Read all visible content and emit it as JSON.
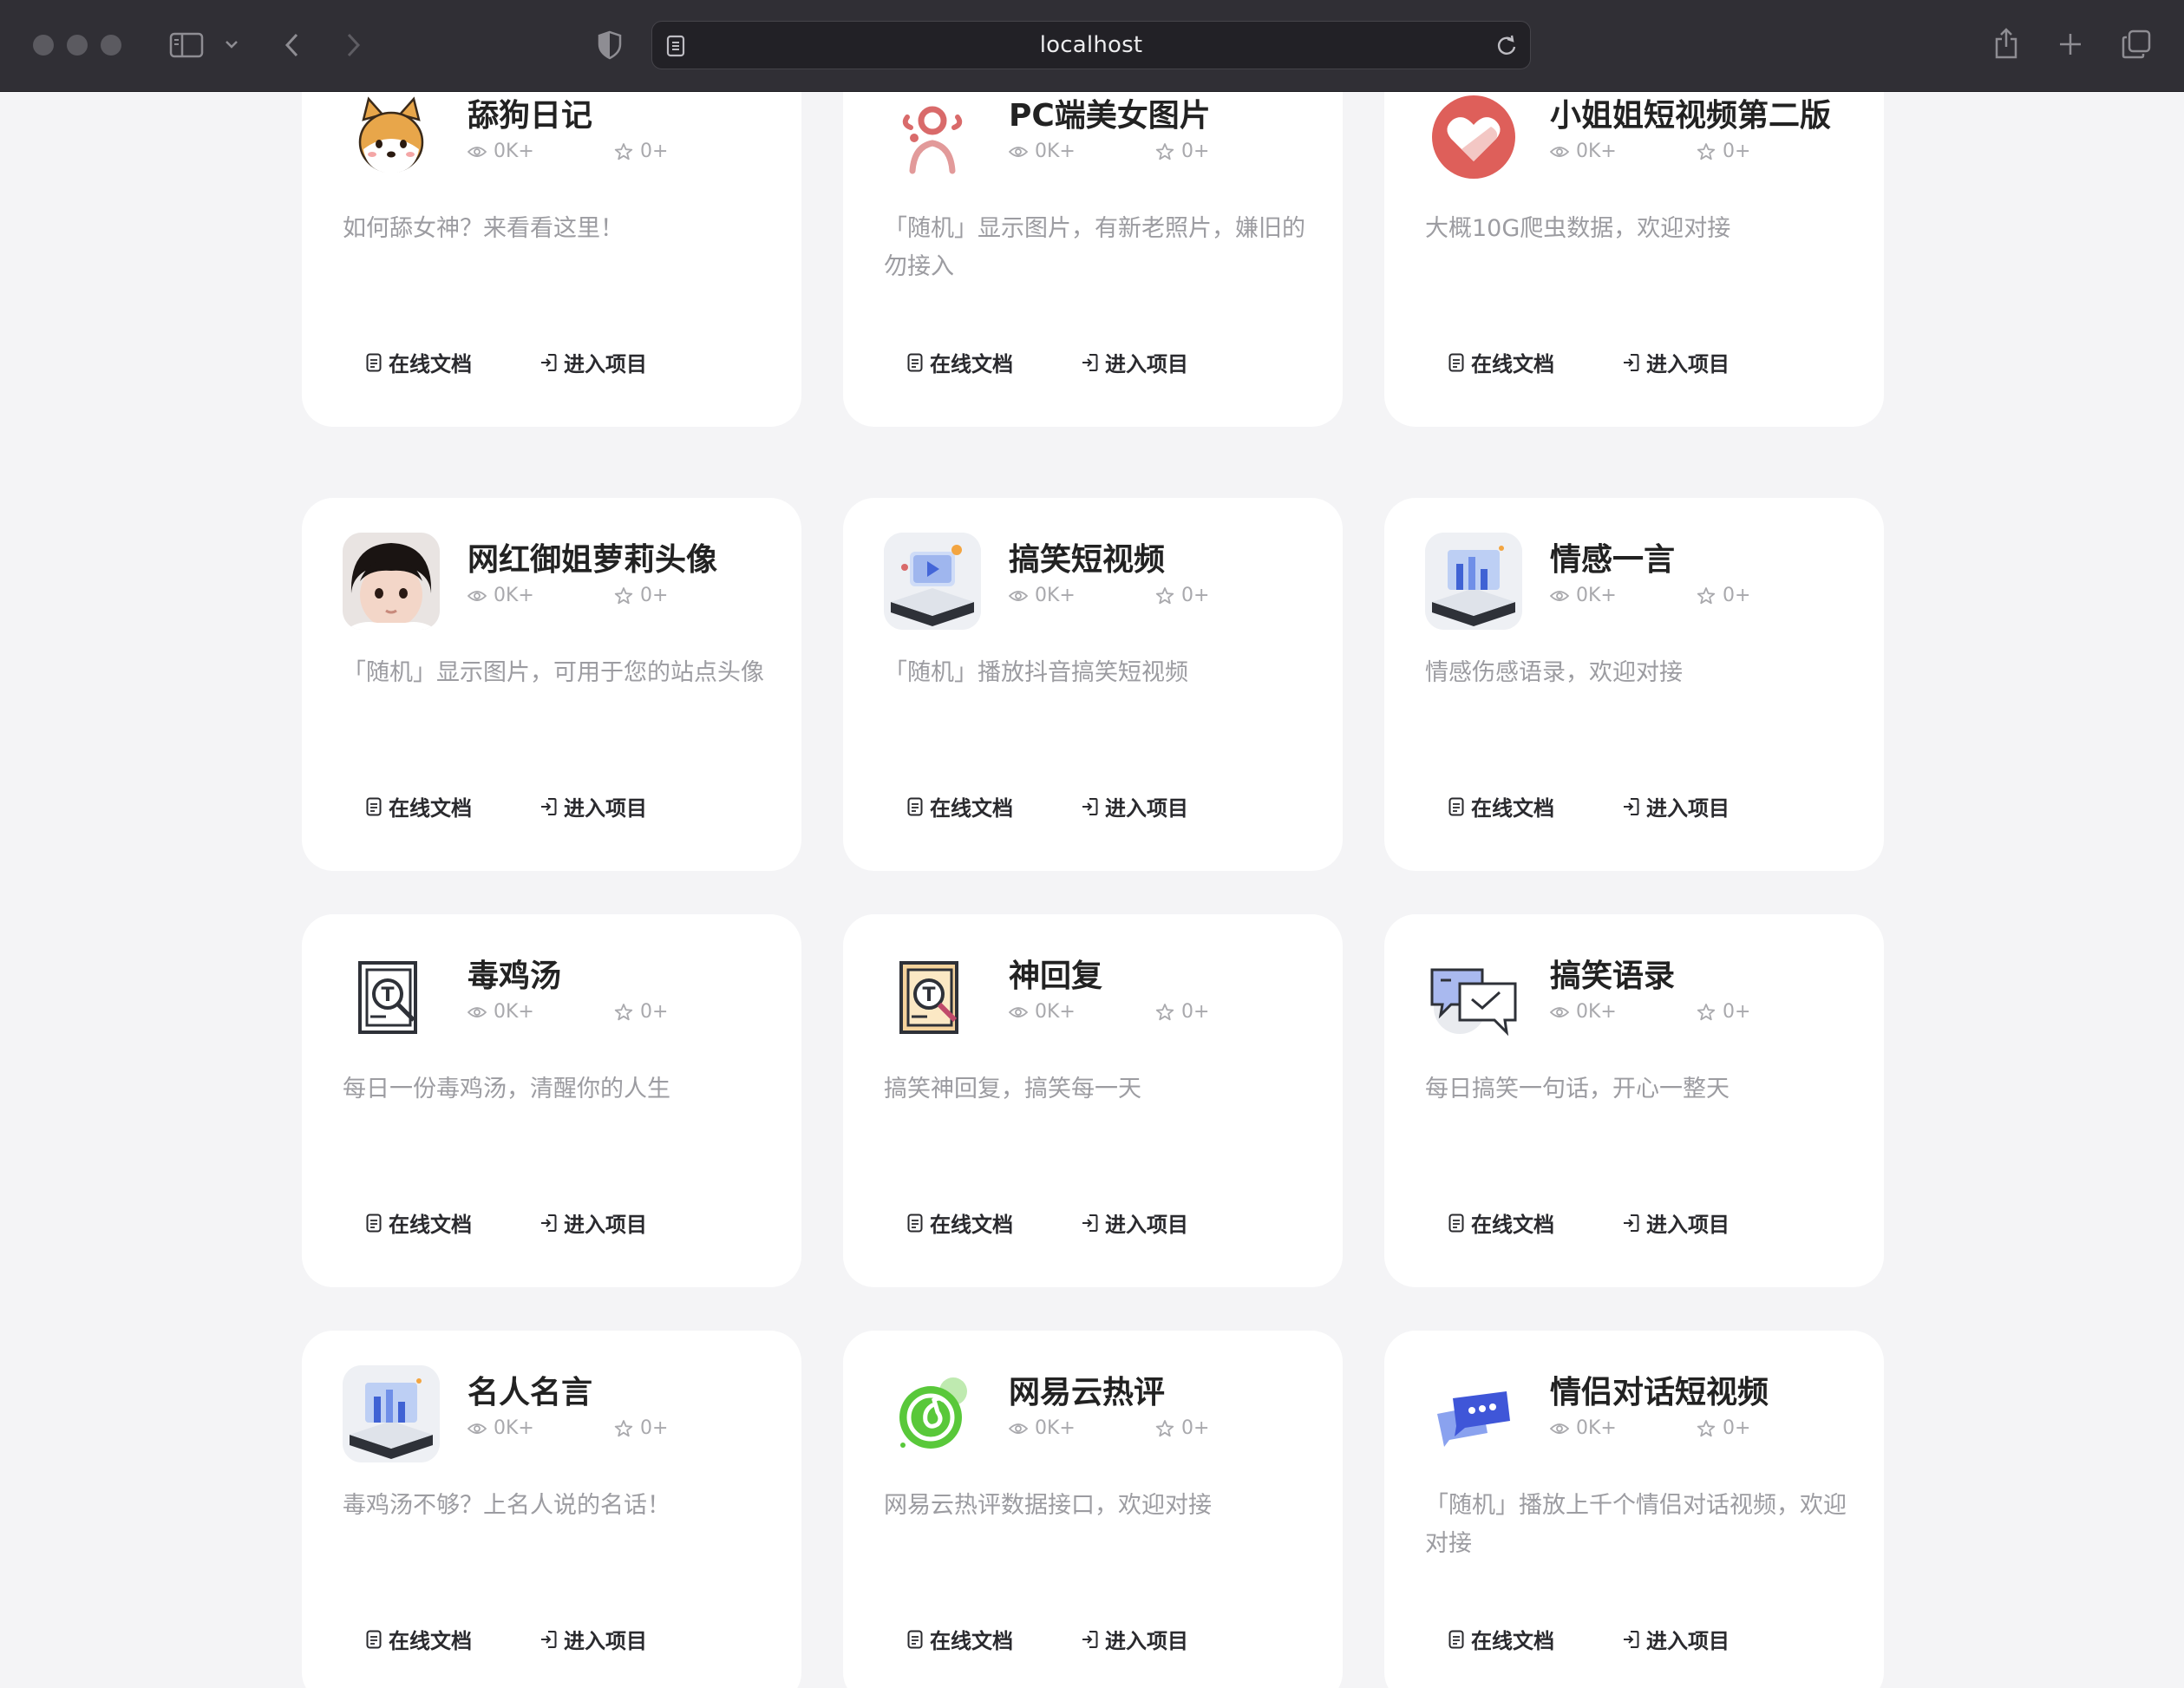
{
  "browser": {
    "url": "localhost"
  },
  "labels": {
    "doc": "在线文档",
    "enter": "进入项目"
  },
  "cards": [
    {
      "title": "舔狗日记",
      "views": "0K+",
      "stars": "0+",
      "desc": "如何舔女神？来看看这里！",
      "icon": "shiba-dog-icon"
    },
    {
      "title": "PC端美女图片",
      "views": "0K+",
      "stars": "0+",
      "desc": "「随机」显示图片，有新老照片，嫌旧的勿接入",
      "icon": "person-logo-icon"
    },
    {
      "title": "小姐姐短视频第二版",
      "views": "0K+",
      "stars": "0+",
      "desc": "大概10G爬虫数据，欢迎对接",
      "icon": "heart-circle-icon"
    },
    {
      "title": "网红御姐萝莉头像",
      "views": "0K+",
      "stars": "0+",
      "desc": "「随机」显示图片，可用于您的站点头像",
      "icon": "child-avatar-icon"
    },
    {
      "title": "搞笑短视频",
      "views": "0K+",
      "stars": "0+",
      "desc": "「随机」播放抖音搞笑短视频",
      "icon": "video-platform-icon"
    },
    {
      "title": "情感一言",
      "views": "0K+",
      "stars": "0+",
      "desc": "情感伤感语录，欢迎对接",
      "icon": "chart-platform-icon"
    },
    {
      "title": "毒鸡汤",
      "views": "0K+",
      "stars": "0+",
      "desc": "每日一份毒鸡汤，清醒你的人生",
      "icon": "text-book-outline-icon"
    },
    {
      "title": "神回复",
      "views": "0K+",
      "stars": "0+",
      "desc": "搞笑神回复，搞笑每一天",
      "icon": "text-book-color-icon"
    },
    {
      "title": "搞笑语录",
      "views": "0K+",
      "stars": "0+",
      "desc": "每日搞笑一句话，开心一整天",
      "icon": "chat-bubbles-icon"
    },
    {
      "title": "名人名言",
      "views": "0K+",
      "stars": "0+",
      "desc": "毒鸡汤不够？上名人说的名话！",
      "icon": "chart-platform-icon"
    },
    {
      "title": "网易云热评",
      "views": "0K+",
      "stars": "0+",
      "desc": "网易云热评数据接口，欢迎对接",
      "icon": "netease-music-icon"
    },
    {
      "title": "情侣对话短视频",
      "views": "0K+",
      "stars": "0+",
      "desc": "「随机」播放上千个情侣对话视频，欢迎对接",
      "icon": "message-bubble-icon"
    }
  ]
}
